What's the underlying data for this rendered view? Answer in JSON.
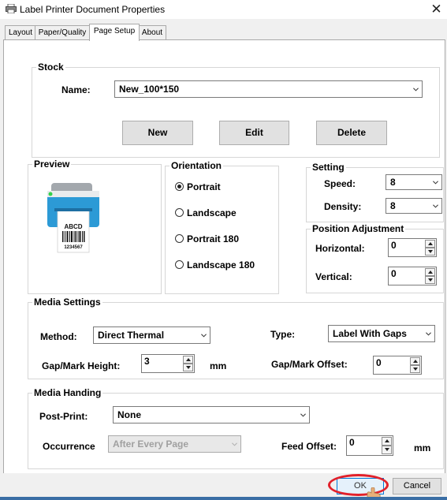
{
  "window": {
    "title": "Label Printer Document Properties",
    "close_symbol": "✕"
  },
  "tabs": [
    {
      "label": "Layout"
    },
    {
      "label": "Paper/Quality"
    },
    {
      "label": "Page Setup"
    },
    {
      "label": "About"
    }
  ],
  "stock": {
    "legend": "Stock",
    "name_label": "Name:",
    "name_value": "New_100*150",
    "new_label": "New",
    "edit_label": "Edit",
    "delete_label": "Delete"
  },
  "preview": {
    "legend": "Preview",
    "label_text": "ABCD",
    "barcode_number": "1234567"
  },
  "orientation": {
    "legend": "Orientation",
    "options": [
      "Portrait",
      "Landscape",
      "Portrait 180",
      "Landscape 180"
    ],
    "selected": "Portrait"
  },
  "setting": {
    "legend": "Setting",
    "speed_label": "Speed:",
    "speed_value": "8",
    "density_label": "Density:",
    "density_value": "8"
  },
  "position": {
    "legend": "Position Adjustment",
    "horizontal_label": "Horizontal:",
    "horizontal_value": "0",
    "vertical_label": "Vertical:",
    "vertical_value": "0"
  },
  "media": {
    "legend": "Media Settings",
    "method_label": "Method:",
    "method_value": "Direct Thermal",
    "type_label": "Type:",
    "type_value": "Label With Gaps",
    "gap_height_label": "Gap/Mark Height:",
    "gap_height_value": "3",
    "gap_height_unit": "mm",
    "gap_offset_label": "Gap/Mark Offset:",
    "gap_offset_value": "0"
  },
  "handling": {
    "legend": "Media Handing",
    "post_print_label": "Post-Print:",
    "post_print_value": "None",
    "occurrence_label": "Occurrence",
    "occurrence_value": "After Every Page",
    "feed_offset_label": "Feed Offset:",
    "feed_offset_value": "0",
    "feed_offset_unit": "mm"
  },
  "footer": {
    "ok_label": "OK",
    "cancel_label": "Cancel"
  },
  "colors": {
    "highlight_ring": "#e2202a",
    "printer_blue": "#2c9ad6",
    "ok_border": "#0078d7"
  }
}
